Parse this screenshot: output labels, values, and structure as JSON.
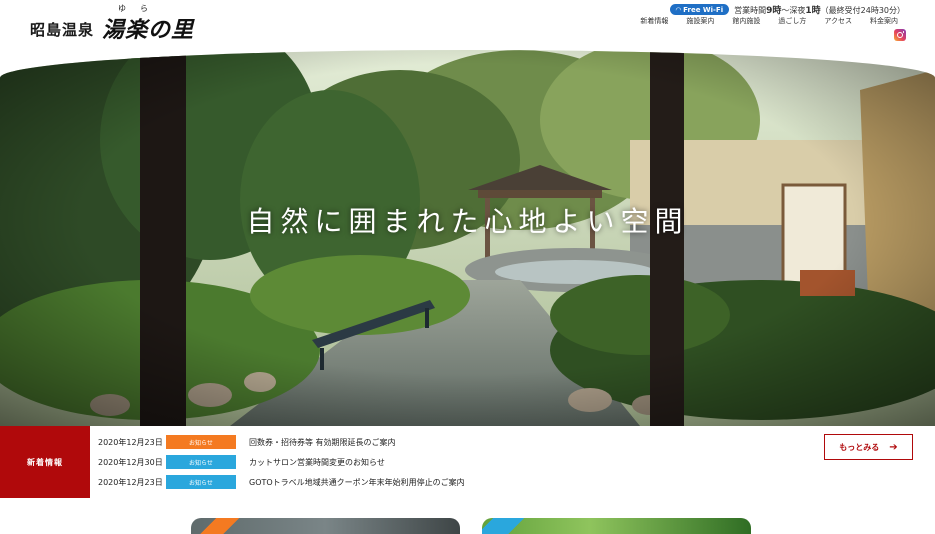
{
  "logo": {
    "small": "昭島温泉",
    "big": "湯楽の里",
    "ruby": "ゆら"
  },
  "header": {
    "wifi_label": "Free Wi-Fi",
    "hours_prefix": "営業時間",
    "hours_open": "9時",
    "hours_mid": "～深夜",
    "hours_close": "1時",
    "hours_note": "（最終受付24時30分）"
  },
  "nav": [
    {
      "label": "新着情報"
    },
    {
      "label": "施設案内"
    },
    {
      "label": "館内施設"
    },
    {
      "label": "過ごし方"
    },
    {
      "label": "アクセス"
    },
    {
      "label": "料金案内"
    }
  ],
  "hero": {
    "caption": "自然に囲まれた心地よい空間"
  },
  "news": {
    "label": "新着情報",
    "more": "もっとみる",
    "items": [
      {
        "date": "2020年12月23日",
        "tag": "お知らせ",
        "tag_color": "#f47a21",
        "title": "回数券・招待券等 有効期限延長のご案内"
      },
      {
        "date": "2020年12月30日",
        "tag": "お知らせ",
        "tag_color": "#2aa7dd",
        "title": "カットサロン営業時間変更のお知らせ"
      },
      {
        "date": "2020年12月23日",
        "tag": "お知らせ",
        "tag_color": "#2aa7dd",
        "title": "GOTOトラベル地域共通クーポン年末年始利用停止のご案内"
      }
    ]
  },
  "icons": {
    "wifi": "wifi-icon",
    "instagram": "instagram-icon",
    "more_arrow": "arrow-right-icon"
  },
  "colors": {
    "accent_red": "#b0090b",
    "tag_orange": "#f47a21",
    "tag_blue": "#2aa7dd",
    "wifi_blue": "#1f6fc5"
  }
}
